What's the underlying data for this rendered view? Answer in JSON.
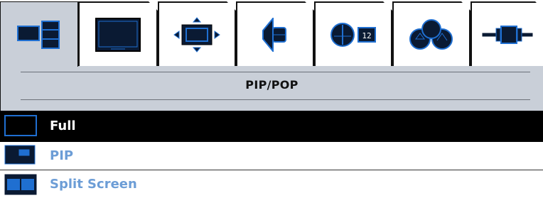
{
  "tabs": [
    {
      "name": "pip-pop-icon",
      "active": true
    },
    {
      "name": "picture-icon",
      "active": false
    },
    {
      "name": "position-icon",
      "active": false
    },
    {
      "name": "audio-icon",
      "active": false
    },
    {
      "name": "clock-icon",
      "active": false
    },
    {
      "name": "color-icon",
      "active": false
    },
    {
      "name": "input-connector-icon",
      "active": false
    }
  ],
  "header": {
    "title": "PIP/POP"
  },
  "menu": {
    "items": [
      {
        "label": "Full",
        "icon": "full-screen-icon",
        "selected": true
      },
      {
        "label": "PIP",
        "icon": "pip-window-icon",
        "selected": false
      },
      {
        "label": "Split Screen",
        "icon": "split-screen-icon",
        "selected": false
      }
    ]
  },
  "clock_tab_badge": "12",
  "colors": {
    "accent_blue": "#1f6fd1",
    "icon_dark": "#0a1a33",
    "panel_gray": "#c9cfd8",
    "inactive_text": "#6c9dd6",
    "selected_bg": "#000000",
    "selected_text": "#ffffff"
  }
}
